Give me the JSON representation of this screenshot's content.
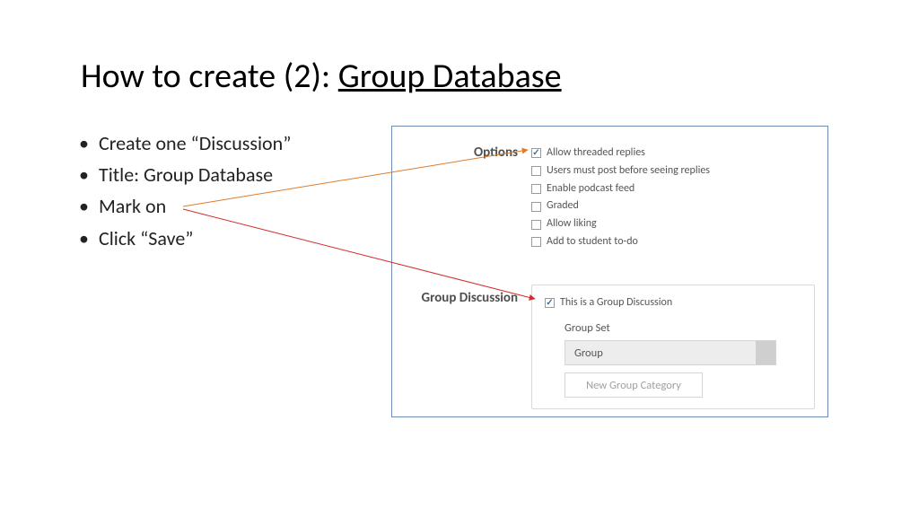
{
  "title": {
    "prefix": "How to create (2): ",
    "underlined": "Group Database"
  },
  "bullets": {
    "b1": "Create one “Discussion”",
    "b2": "Title: Group Database",
    "b3": "Mark on",
    "b4": "Click “Save”"
  },
  "panel": {
    "options_label": "Options",
    "options": {
      "o1": "Allow threaded replies",
      "o2": "Users must post before seeing replies",
      "o3": "Enable podcast feed",
      "o4": "Graded",
      "o5": "Allow liking",
      "o6": "Add to student to-do"
    },
    "group_label": "Group Discussion",
    "group_check": "This is a Group Discussion",
    "group_set_label": "Group Set",
    "group_select_value": "Group",
    "new_group_button": "New Group Category"
  }
}
